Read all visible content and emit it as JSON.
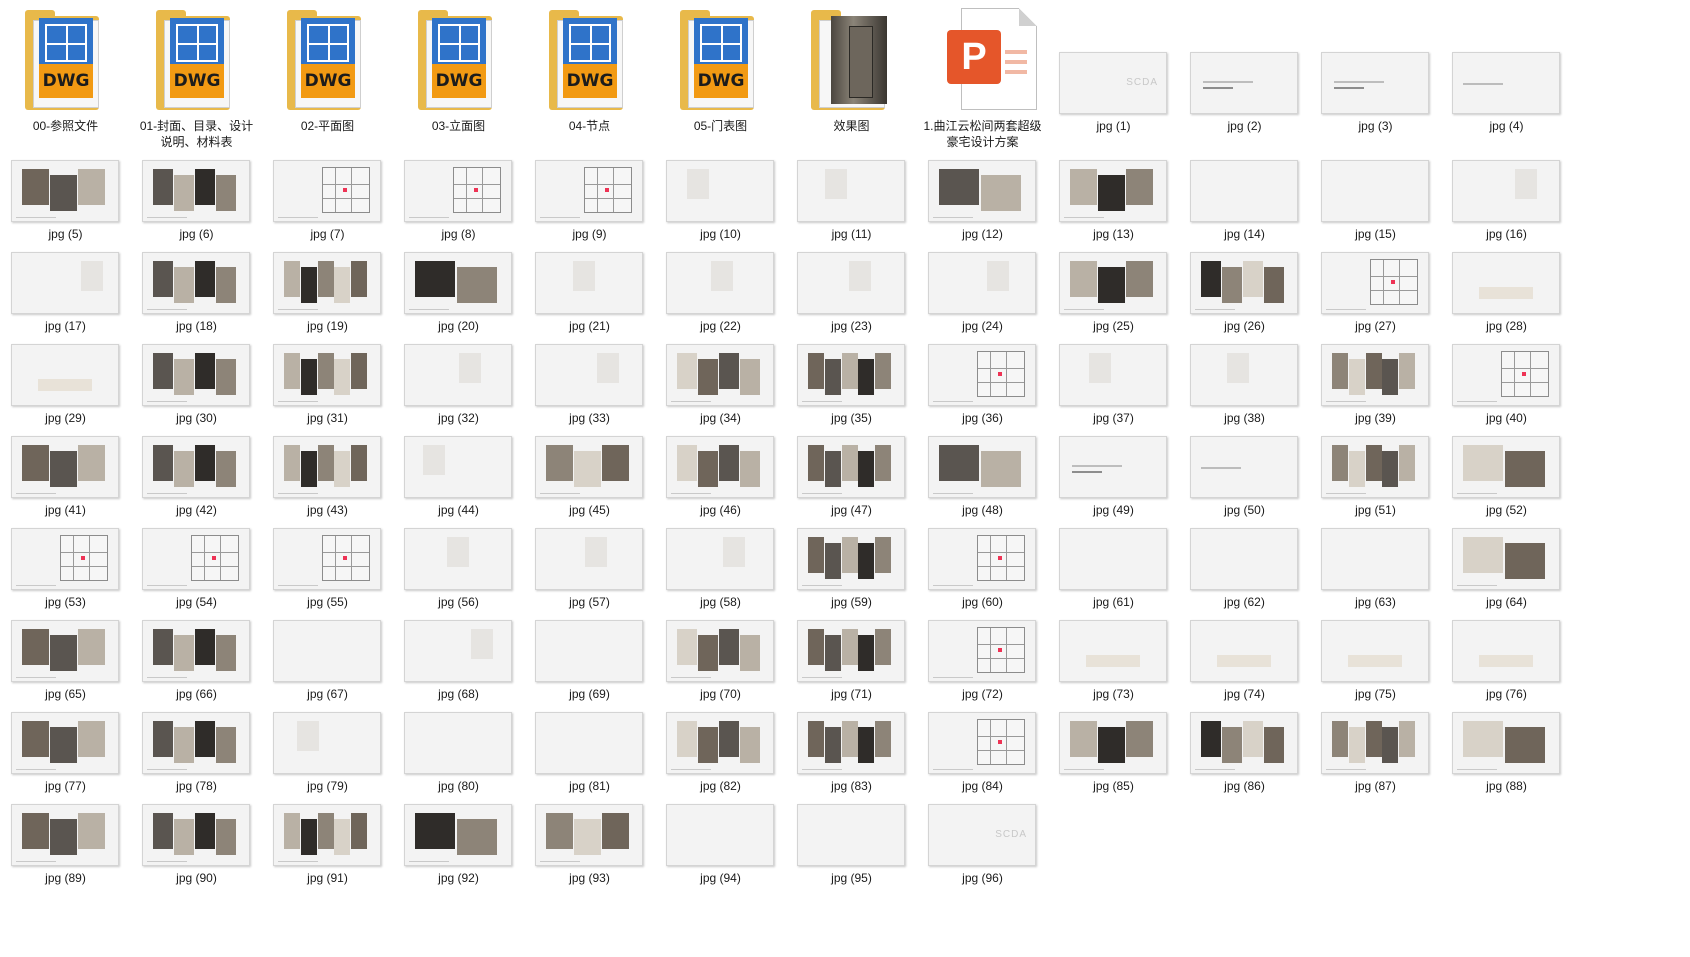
{
  "folders": [
    {
      "name": "00-参照文件",
      "icon": "dwg-folder-icon"
    },
    {
      "name": "01-封面、目录、设计说明、材料表",
      "icon": "dwg-folder-icon"
    },
    {
      "name": "02-平面图",
      "icon": "dwg-folder-icon"
    },
    {
      "name": "03-立面图",
      "icon": "dwg-folder-icon"
    },
    {
      "name": "04-节点",
      "icon": "dwg-folder-icon"
    },
    {
      "name": "05-门表图",
      "icon": "dwg-folder-icon"
    },
    {
      "name": "效果图",
      "icon": "image-folder-icon"
    }
  ],
  "ppt_file": {
    "name": "1.曲江云松间两套超级豪宅设计方案",
    "icon": "powerpoint-file-icon",
    "glyph": "P"
  },
  "dwg_text": "DWG",
  "scda_text": "SCDA",
  "thumb_count": 96,
  "thumb_label_prefix": "jpg (",
  "thumb_label_suffix": ")",
  "thumb_styles": [
    "light",
    "dark",
    "dark",
    "light",
    "mat",
    "mat",
    "plan",
    "plan",
    "plan",
    "room",
    "room",
    "mat",
    "mat",
    "room2",
    "room2",
    "room",
    "room",
    "mat",
    "mat",
    "mat",
    "room",
    "room",
    "room",
    "room",
    "mat",
    "mat",
    "plan",
    "bed",
    "bed",
    "mat",
    "mat",
    "room",
    "room",
    "mat",
    "mat",
    "plan",
    "room",
    "room",
    "mat",
    "plan",
    "mat",
    "mat",
    "mat",
    "room",
    "mat",
    "mat",
    "mat",
    "mat",
    "dark",
    "light",
    "mat",
    "mat",
    "plan",
    "plan",
    "plan",
    "room",
    "room",
    "room",
    "mat",
    "plan",
    "room2",
    "room2",
    "room2",
    "mat",
    "mat",
    "mat",
    "room2",
    "room",
    "room2",
    "mat",
    "mat",
    "plan",
    "bed",
    "bed",
    "bed",
    "bed",
    "mat",
    "mat",
    "room",
    "room2",
    "room2",
    "mat",
    "mat",
    "plan",
    "mat",
    "mat",
    "mat",
    "mat",
    "mat",
    "mat",
    "mat",
    "mat",
    "mat",
    "corr",
    "corr",
    "light"
  ]
}
